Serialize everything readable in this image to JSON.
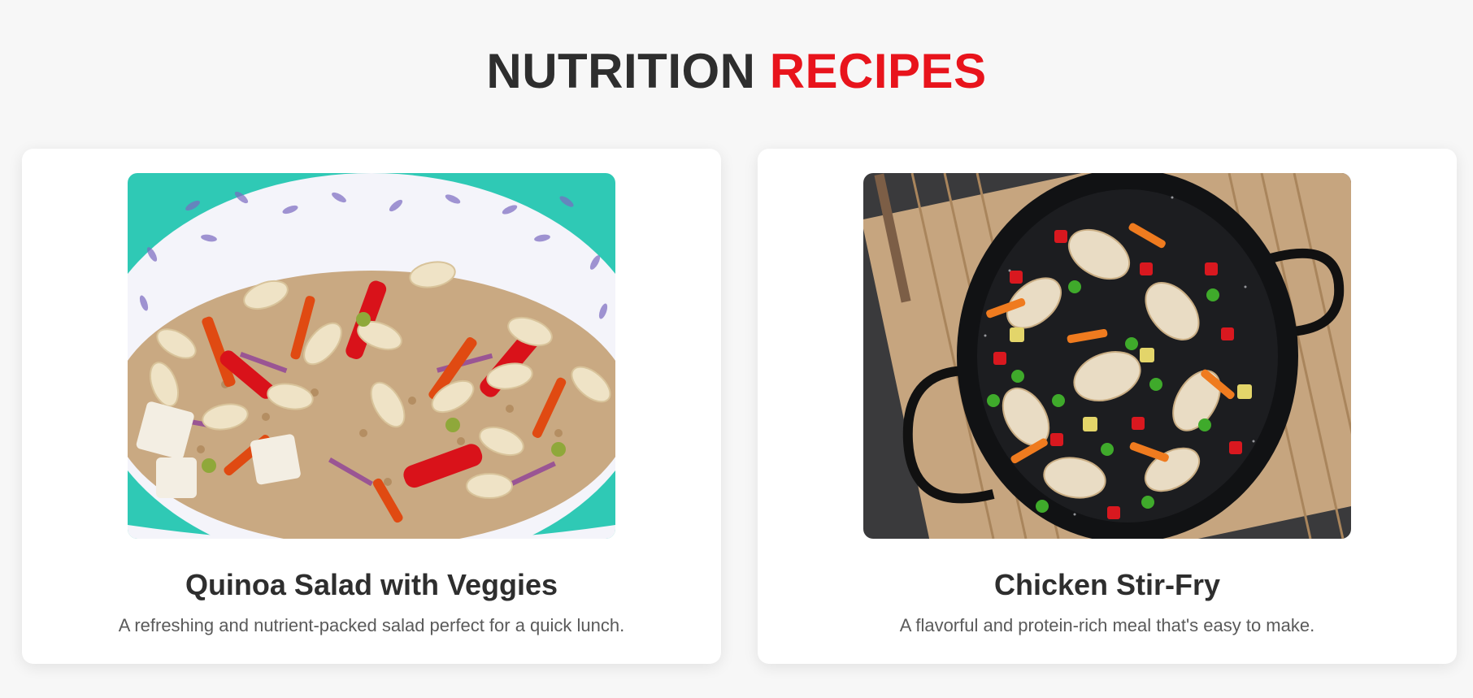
{
  "header": {
    "title_part1": "NUTRITION",
    "title_part2": "RECIPES"
  },
  "colors": {
    "accent": "#e8141c",
    "text_dark": "#2e2e2e",
    "text_muted": "#5a5a5a",
    "background": "#f7f7f7",
    "card": "#ffffff"
  },
  "recipes": [
    {
      "title": "Quinoa Salad with Veggies",
      "description": "A refreshing and nutrient-packed salad perfect for a quick lunch.",
      "image_icon": "quinoa-salad-photo"
    },
    {
      "title": "Chicken Stir-Fry",
      "description": "A flavorful and protein-rich meal that's easy to make.",
      "image_icon": "chicken-stir-fry-photo"
    }
  ]
}
